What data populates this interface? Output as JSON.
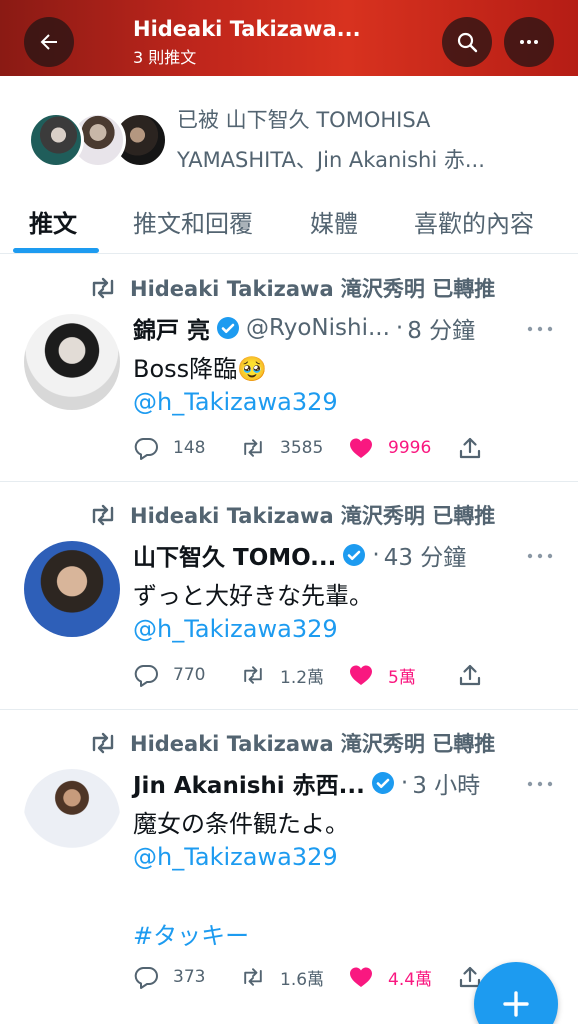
{
  "header": {
    "title": "Hideaki Takizawa...",
    "subtitle": "3 則推文",
    "gradient_colors": [
      "#8a1a14",
      "#d8321f"
    ]
  },
  "followed_by": {
    "line1": "已被 山下智久 TOMOHISA",
    "line2": "YAMASHITA、Jin Akanishi  赤..."
  },
  "tabs": [
    {
      "label": "推文",
      "active": true
    },
    {
      "label": "推文和回覆",
      "active": false
    },
    {
      "label": "媒體",
      "active": false
    },
    {
      "label": "喜歡的內容",
      "active": false
    }
  ],
  "colors": {
    "accent": "#1d9bf0",
    "like": "#f91880",
    "muted": "#536471"
  },
  "tweets": [
    {
      "retweeted_by": "Hideaki Takizawa 滝沢秀明 已轉推",
      "name": "錦戸 亮",
      "verified": true,
      "handle": "@RyoNishi...",
      "time": "8 分鐘",
      "text": "Boss降臨🥹",
      "mention": "@h_Takizawa329",
      "hashtag": "",
      "replies": "148",
      "retweets": "3585",
      "likes": "9996",
      "liked": true
    },
    {
      "retweeted_by": "Hideaki Takizawa 滝沢秀明 已轉推",
      "name": "山下智久 TOMO...",
      "verified": true,
      "handle": "",
      "time": "43 分鐘",
      "text": "ずっと大好きな先輩。",
      "mention": "@h_Takizawa329",
      "hashtag": "",
      "replies": "770",
      "retweets": "1.2萬",
      "likes": "5萬",
      "liked": true
    },
    {
      "retweeted_by": "Hideaki Takizawa 滝沢秀明 已轉推",
      "name": "Jin Akanishi  赤西...",
      "verified": true,
      "handle": "",
      "time": "3 小時",
      "text": "魔女の条件観たよ。",
      "mention": "@h_Takizawa329",
      "hashtag": "#タッキー",
      "replies": "373",
      "retweets": "1.6萬",
      "likes": "4.4萬",
      "liked": true
    }
  ],
  "icons": {
    "back": "arrow-left-icon",
    "search": "search-icon",
    "more": "more-icon",
    "retweet": "retweet-icon",
    "verified": "verified-badge-icon",
    "reply": "reply-icon",
    "like": "heart-icon",
    "share": "share-icon",
    "compose": "plus-icon"
  }
}
